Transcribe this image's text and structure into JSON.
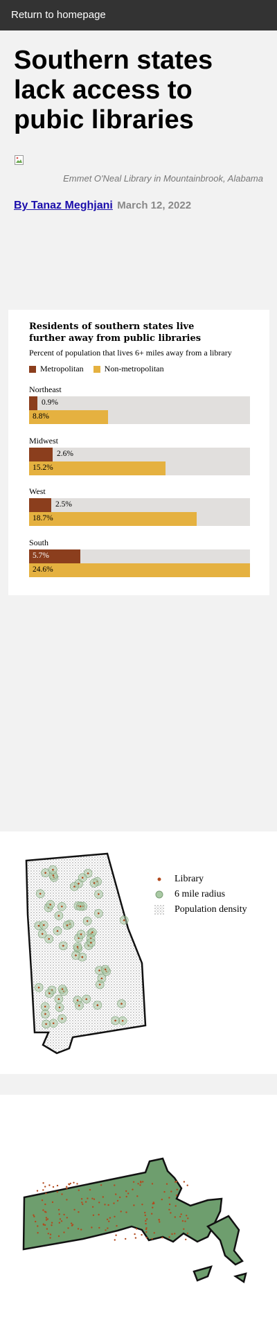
{
  "nav": {
    "home_link": "Return to homepage"
  },
  "article": {
    "headline": "Southern states lack access to pubic libraries",
    "photo_caption": "Emmet O'Neal Library in Mountainbrook, Alabama",
    "author": "By Tanaz Meghjani",
    "date": "March 12, 2022"
  },
  "colors": {
    "metropolitan": "#8b3e1d",
    "non_metropolitan": "#e5b140",
    "track": "#e1dfdd",
    "map_fill": "#6e9e6e",
    "library_dot": "#b24a1e"
  },
  "chart_data": {
    "type": "bar",
    "title": "Residents of southern states live further away from public libraries",
    "subtitle": "Percent of population that lives 6+ miles away from a library",
    "legend": [
      "Metropolitan",
      "Non-metropolitan"
    ],
    "categories": [
      "Northeast",
      "Midwest",
      "West",
      "South"
    ],
    "series": [
      {
        "name": "Metropolitan",
        "values": [
          0.9,
          2.6,
          2.5,
          5.7
        ],
        "labels": [
          "0.9%",
          "2.6%",
          "2.5%",
          "5.7%"
        ]
      },
      {
        "name": "Non-metropolitan",
        "values": [
          8.8,
          15.2,
          18.7,
          24.6
        ],
        "labels": [
          "8.8%",
          "15.2%",
          "18.7%",
          "24.6%"
        ]
      }
    ],
    "xlim": [
      0,
      24.6
    ]
  },
  "map_legend": {
    "library": "Library",
    "radius": "6 mile radius",
    "density": "Population density"
  }
}
